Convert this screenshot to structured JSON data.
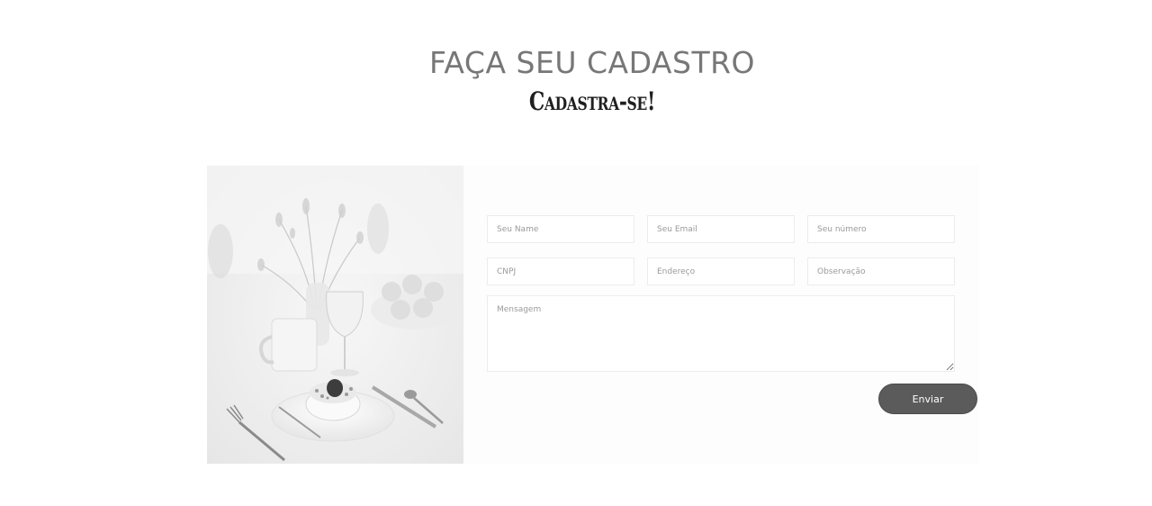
{
  "header": {
    "title": "FAÇA SEU CADASTRO",
    "subtitle": "Cadastra-se!"
  },
  "form": {
    "fields": {
      "name": {
        "placeholder": "Seu Name",
        "value": ""
      },
      "email": {
        "placeholder": "Seu Email",
        "value": ""
      },
      "phone": {
        "placeholder": "Seu número",
        "value": ""
      },
      "cnpj": {
        "placeholder": "CNPJ",
        "value": ""
      },
      "address": {
        "placeholder": "Endereço",
        "value": ""
      },
      "notes": {
        "placeholder": "Observação",
        "value": ""
      },
      "message": {
        "placeholder": "Mensagem",
        "value": ""
      }
    },
    "submit_label": "Enviar"
  },
  "colors": {
    "title": "#777777",
    "subtitle": "#1f1f1f",
    "button": "#5b5b5b",
    "field_border": "#ececec"
  }
}
